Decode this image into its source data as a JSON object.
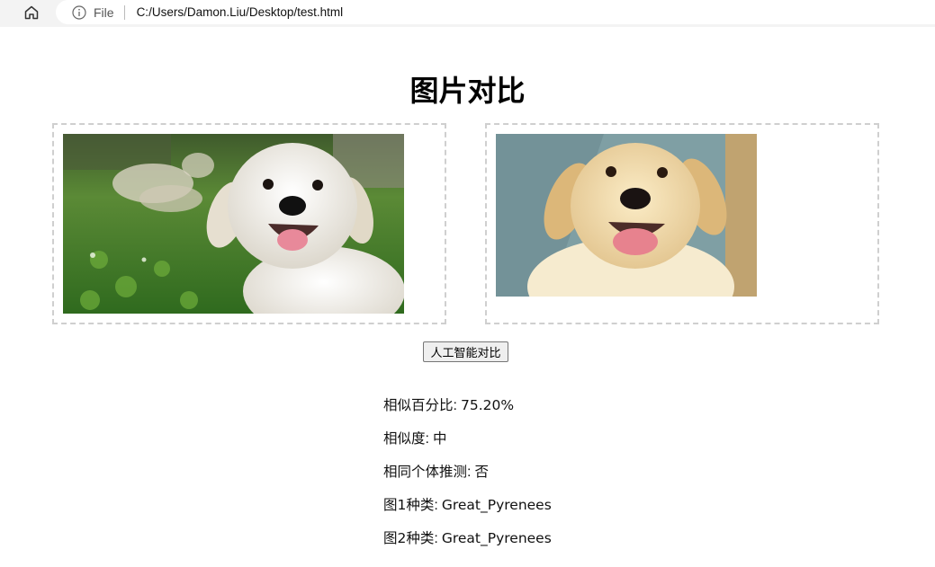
{
  "browser": {
    "scheme_label": "File",
    "url": "C:/Users/Damon.Liu/Desktop/test.html"
  },
  "page": {
    "title": "图片对比",
    "compare_button": "人工智能对比"
  },
  "results": [
    {
      "label": "相似百分比",
      "value": "75.20%"
    },
    {
      "label": "相似度",
      "value": "中"
    },
    {
      "label": "相同个体推测",
      "value": "否"
    },
    {
      "label": "图1种类",
      "value": "Great_Pyrenees"
    },
    {
      "label": "图2种类",
      "value": "Great_Pyrenees"
    }
  ]
}
